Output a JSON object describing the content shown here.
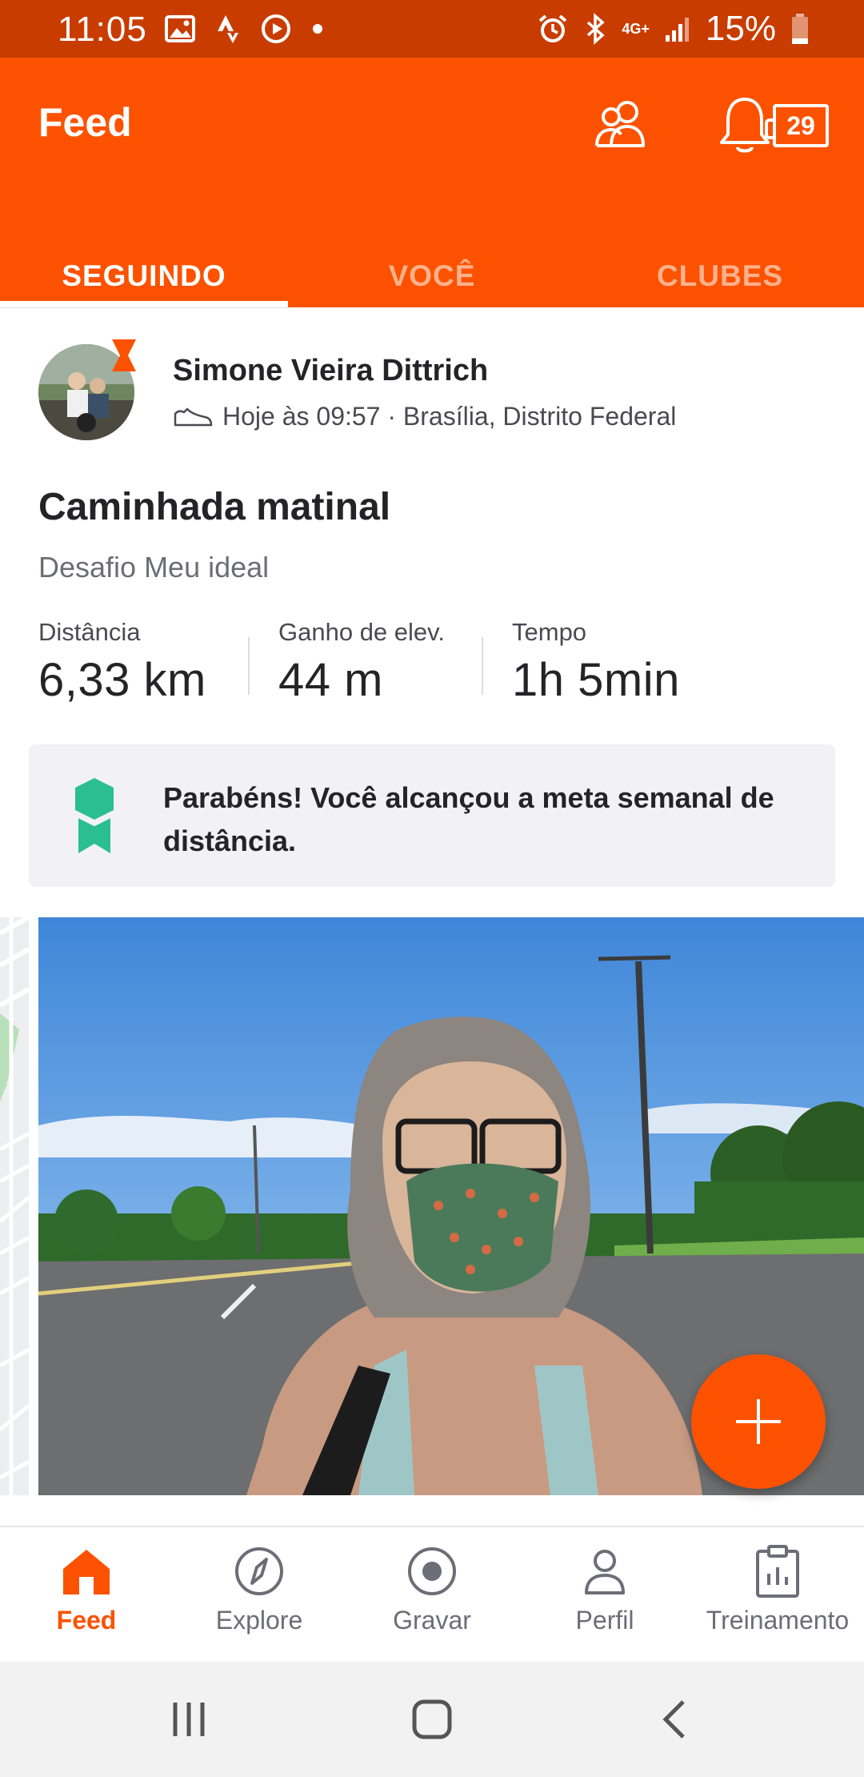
{
  "status_bar": {
    "time": "11:05",
    "network": "4G+",
    "battery": "15%"
  },
  "header": {
    "title": "Feed",
    "notification_count": "29",
    "tabs": [
      {
        "label": "SEGUINDO",
        "active": true
      },
      {
        "label": "VOCÊ",
        "active": false
      },
      {
        "label": "CLUBES",
        "active": false
      }
    ]
  },
  "activity": {
    "athlete_name": "Simone Vieira Dittrich",
    "meta": "Hoje às 09:57 · Brasília, Distrito Federal",
    "title": "Caminhada matinal",
    "description": "Desafio Meu ideal",
    "stats": [
      {
        "label": "Distância",
        "value": "6,33 km"
      },
      {
        "label": "Ganho de elev.",
        "value": "44 m"
      },
      {
        "label": "Tempo",
        "value": "1h 5min"
      }
    ],
    "goal_message": "Parabéns! Você alcançou a meta semanal de distância."
  },
  "bottom_nav": [
    {
      "label": "Feed",
      "icon": "home-icon",
      "active": true
    },
    {
      "label": "Explore",
      "icon": "compass-icon",
      "active": false
    },
    {
      "label": "Gravar",
      "icon": "record-icon",
      "active": false
    },
    {
      "label": "Perfil",
      "icon": "person-icon",
      "active": false
    },
    {
      "label": "Treinamento",
      "icon": "clipboard-chart-icon",
      "active": false
    }
  ],
  "colors": {
    "brand": "#fc5200",
    "status_bar": "#c93c00",
    "goal_badge": "#2bbf8f"
  }
}
